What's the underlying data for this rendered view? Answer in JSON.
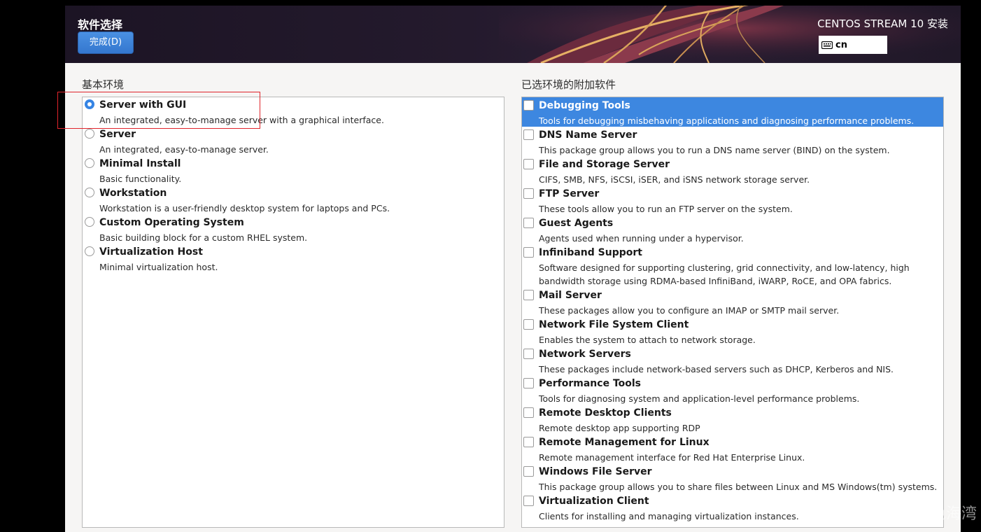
{
  "header": {
    "title": "软件选择",
    "done_label": "完成(D)",
    "product": "CENTOS STREAM 10 安装",
    "keyboard_icon": "keyboard-icon",
    "keyboard_layout": "cn"
  },
  "base_env": {
    "label": "基本环境",
    "items": [
      {
        "name": "Server with GUI",
        "desc": "An integrated, easy-to-manage server with a graphical interface."
      },
      {
        "name": "Server",
        "desc": "An integrated, easy-to-manage server."
      },
      {
        "name": "Minimal Install",
        "desc": "Basic functionality."
      },
      {
        "name": "Workstation",
        "desc": "Workstation is a user-friendly desktop system for laptops and PCs."
      },
      {
        "name": "Custom Operating System",
        "desc": "Basic building block for a custom RHEL system."
      },
      {
        "name": "Virtualization Host",
        "desc": "Minimal virtualization host."
      }
    ]
  },
  "addons": {
    "label": "已选环境的附加软件",
    "items": [
      {
        "name": "Debugging Tools",
        "desc": "Tools for debugging misbehaving applications and diagnosing performance problems."
      },
      {
        "name": "DNS Name Server",
        "desc": "This package group allows you to run a DNS name server (BIND) on the system."
      },
      {
        "name": "File and Storage Server",
        "desc": "CIFS, SMB, NFS, iSCSI, iSER, and iSNS network storage server."
      },
      {
        "name": "FTP Server",
        "desc": "These tools allow you to run an FTP server on the system."
      },
      {
        "name": "Guest Agents",
        "desc": "Agents used when running under a hypervisor."
      },
      {
        "name": "Infiniband Support",
        "desc": "Software designed for supporting clustering, grid connectivity, and low-latency, high",
        "desc2": "bandwidth storage using RDMA-based InfiniBand, iWARP, RoCE, and OPA fabrics."
      },
      {
        "name": "Mail Server",
        "desc": "These packages allow you to configure an IMAP or SMTP mail server."
      },
      {
        "name": "Network File System Client",
        "desc": "Enables the system to attach to network storage."
      },
      {
        "name": "Network Servers",
        "desc": "These packages include network-based servers such as DHCP, Kerberos and NIS."
      },
      {
        "name": "Performance Tools",
        "desc": "Tools for diagnosing system and application-level performance problems."
      },
      {
        "name": "Remote Desktop Clients",
        "desc": "Remote desktop app supporting RDP"
      },
      {
        "name": "Remote Management for Linux",
        "desc": "Remote management interface for Red Hat Enterprise Linux."
      },
      {
        "name": "Windows File Server",
        "desc": "This package group allows you to share files between Linux and MS Windows(tm) systems."
      },
      {
        "name": "Virtualization Client",
        "desc": "Clients for installing and managing virtualization instances."
      }
    ]
  },
  "watermark": "CSDN @荭色海湾",
  "colors": {
    "accent": "#3584e4",
    "selection": "#3d87e0",
    "annotation": "#e0242b"
  }
}
